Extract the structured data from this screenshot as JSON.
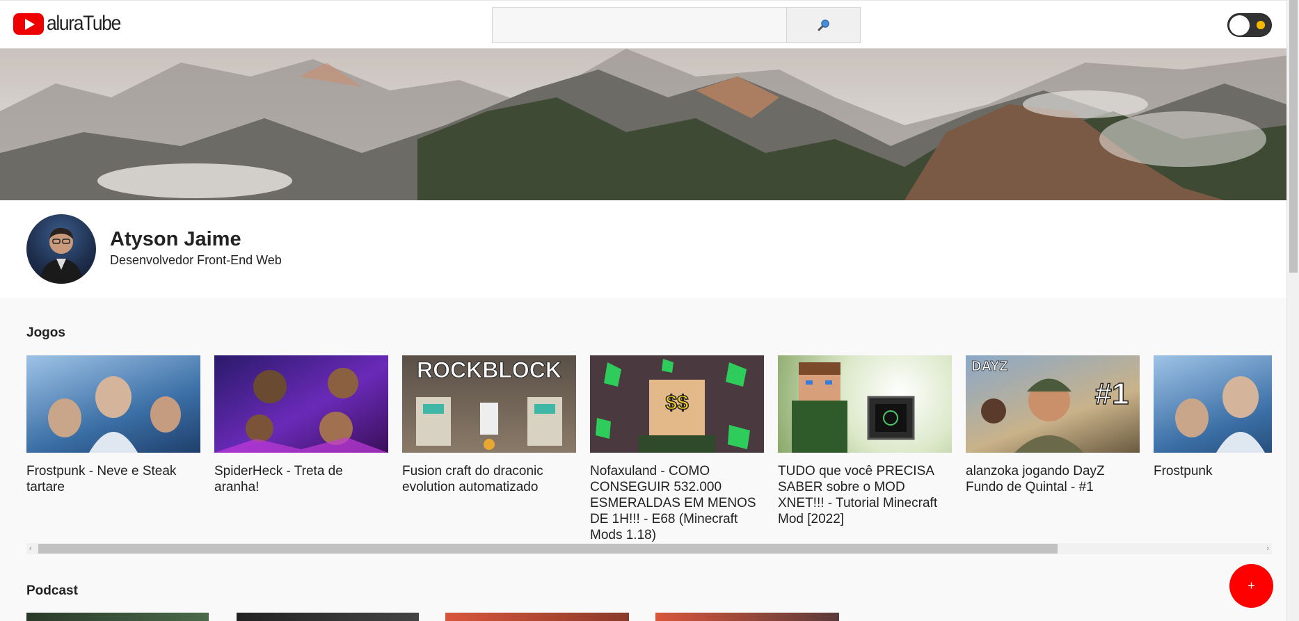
{
  "header": {
    "logo_text": "aluraTube",
    "search": {
      "placeholder": "",
      "value": ""
    },
    "search_button_icon": "search-icon",
    "theme_toggle": {
      "state": "light",
      "icon": "sun-icon"
    }
  },
  "profile": {
    "name": "Atyson Jaime",
    "role": "Desenvolvedor Front-End Web"
  },
  "sections": [
    {
      "title": "Jogos",
      "videos": [
        {
          "title": "Frostpunk - Neve e Steak tartare"
        },
        {
          "title": "SpiderHeck - Treta de aranha!"
        },
        {
          "title": "Fusion craft do draconic evolution automatizado",
          "thumb_text": "ROCKBLOCK"
        },
        {
          "title": "Nofaxuland - COMO CONSEGUIR 532.000 ESMERALDAS EM MENOS DE 1H!!! - E68 (Minecraft Mods 1.18)",
          "thumb_text": "$$"
        },
        {
          "title": "TUDO que você PRECISA SABER sobre o MOD XNET!!! - Tutorial Minecraft Mod [2022]"
        },
        {
          "title": "alanzoka jogando DayZ Fundo de Quintal - #1",
          "thumb_text": "DAYZ",
          "thumb_badge": "#1"
        },
        {
          "title": "Frostpunk"
        }
      ]
    },
    {
      "title": "Podcast",
      "videos": []
    }
  ],
  "fab": {
    "label": "+"
  },
  "colors": {
    "brand": "#ff0000",
    "background": "#f9f9f9"
  }
}
